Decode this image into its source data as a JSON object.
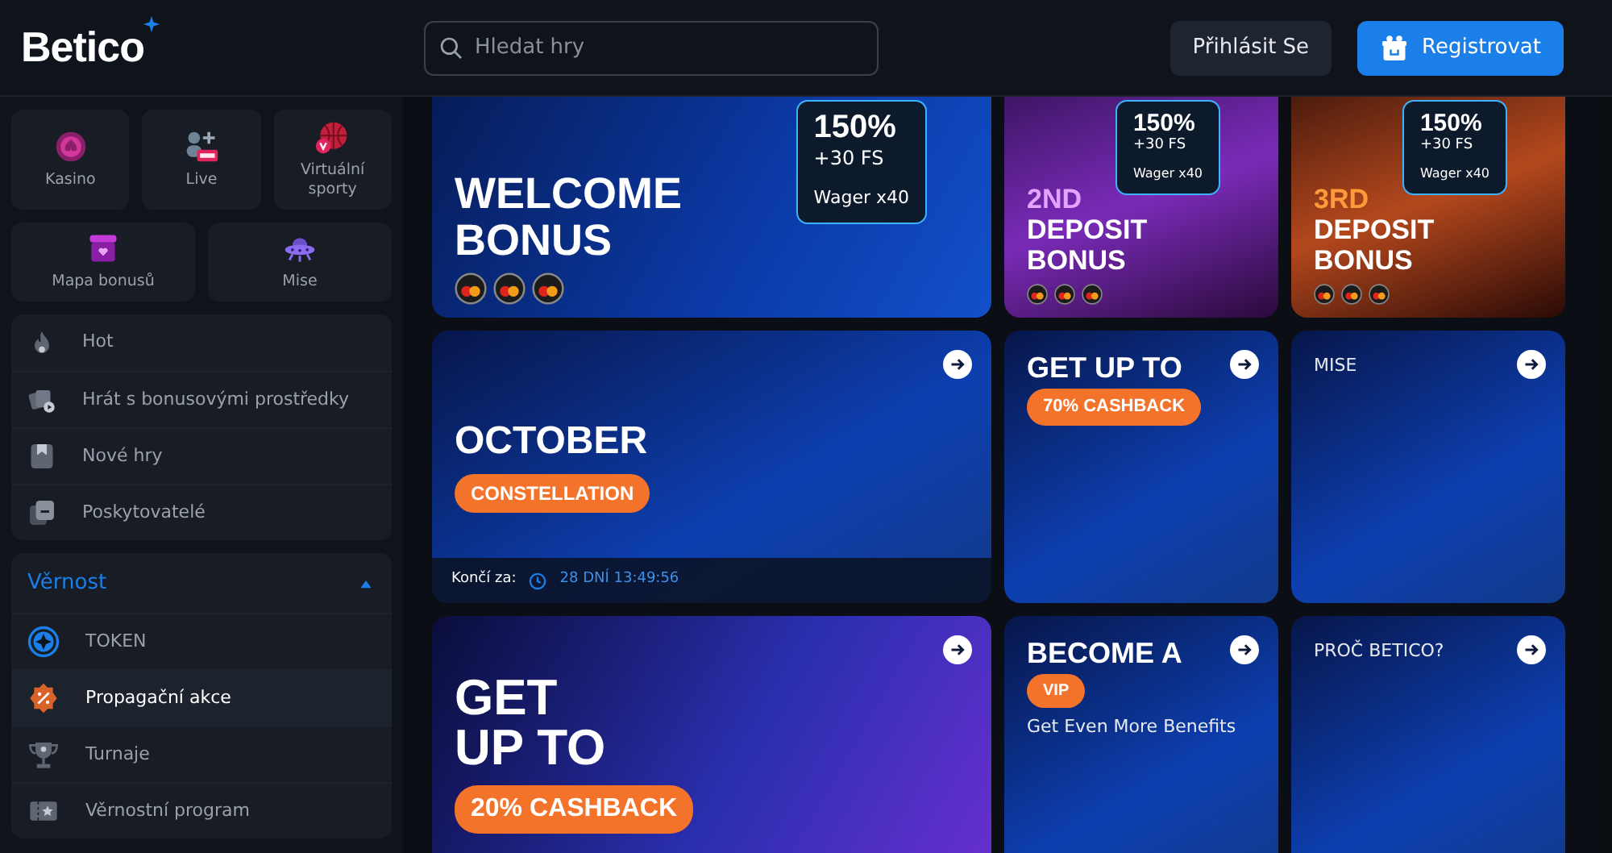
{
  "header": {
    "logo": "Betico",
    "search": {
      "placeholder": "Hledat hry"
    },
    "login": "Přihlásit Se",
    "register": "Registrovat"
  },
  "sidebar": {
    "tiles": [
      {
        "label": "Kasino"
      },
      {
        "label": "Live"
      },
      {
        "label": "Virtuální sporty"
      },
      {
        "label": "Mapa bonusů"
      },
      {
        "label": "Mise"
      }
    ],
    "items": [
      {
        "label": "Hot",
        "selected": false
      },
      {
        "label": "Hrát s bonusovými prostředky",
        "selected": false
      },
      {
        "label": "Nové hry",
        "selected": false
      },
      {
        "label": "Poskytovatelé",
        "selected": false
      }
    ],
    "section": {
      "title": "Věrnost",
      "expanded": true,
      "items": [
        {
          "label": "TOKEN",
          "selected": false
        },
        {
          "label": "Propagační akce",
          "selected": true
        },
        {
          "label": "Turnaje",
          "selected": false
        },
        {
          "label": "Věrnostní program",
          "selected": false
        }
      ]
    }
  },
  "banners": [
    {
      "kind": "welcome",
      "lines": [
        "WELCOME",
        "BONUS"
      ],
      "card": {
        "amount": "150%",
        "extra": "+30 FS",
        "wager": "Wager x40"
      },
      "arrow": false
    },
    {
      "kind": "purple",
      "lines": [
        "2ND",
        "DEPOSIT",
        "BONUS"
      ],
      "card": {
        "amount": "150%",
        "extra": "+30 FS",
        "wager": "Wager x40"
      },
      "arrow": false
    },
    {
      "kind": "orange",
      "lines": [
        "3RD",
        "DEPOSIT",
        "BONUS"
      ],
      "card": {
        "amount": "150%",
        "extra": "+30 FS",
        "wager": "Wager x40"
      },
      "arrow": false
    },
    {
      "kind": "blue",
      "lines": [
        "OCTOBER"
      ],
      "tag": "CONSTELLATION",
      "arrow": true,
      "countdown": {
        "label": "Končí za:",
        "value": "28 DNÍ 13:49:56"
      }
    },
    {
      "kind": "blue",
      "lines": [
        "GET UP TO"
      ],
      "tag": "70% CASHBACK",
      "arrow": true
    },
    {
      "kind": "blue",
      "caption": "MISE",
      "arrow": true
    },
    {
      "kind": "violet",
      "lines": [
        "GET",
        "UP TO"
      ],
      "tag": "20% CASHBACK",
      "arrow": true
    },
    {
      "kind": "blue",
      "lines": [
        "BECOME A"
      ],
      "tag": "VIP",
      "subtitle": "Get Even More Benefits",
      "arrow": true
    },
    {
      "kind": "blue",
      "caption": "PROČ BETICO?",
      "arrow": true
    }
  ]
}
